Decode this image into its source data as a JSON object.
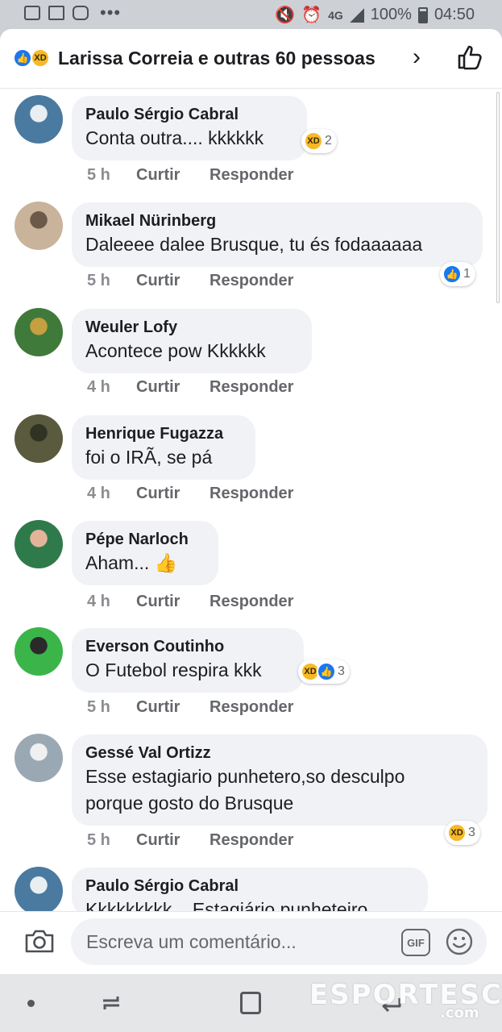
{
  "status_bar": {
    "network": "4G",
    "battery": "100%",
    "time": "04:50",
    "overflow": "•••"
  },
  "header": {
    "title": "Larissa Correia e outras 60 pessoas",
    "reactions": [
      "like",
      "haha"
    ]
  },
  "actions": {
    "like": "Curtir",
    "reply": "Responder"
  },
  "comments": [
    {
      "name": "Paulo Sérgio Cabral",
      "text": "Conta outra.... kkkkkk",
      "time": "5 h",
      "reaction_count": "2",
      "reactions": [
        "haha"
      ],
      "avatar_colors": [
        "#4a7aa0",
        "#e8eef2"
      ]
    },
    {
      "name": "Mikael Nürinberg",
      "text": "Daleeee dalee Brusque, tu és fodaaaaaa",
      "time": "5 h",
      "reaction_count": "1",
      "reactions": [
        "like"
      ],
      "avatar_colors": [
        "#c9b39a",
        "#6b5a48"
      ]
    },
    {
      "name": "Weuler Lofy",
      "text": "Acontece pow Kkkkkk",
      "time": "4 h",
      "reaction_count": "",
      "reactions": [],
      "avatar_colors": [
        "#3f7a3a",
        "#c4a040"
      ]
    },
    {
      "name": "Henrique Fugazza",
      "text": "foi o IRÃ, se pá",
      "time": "4 h",
      "reaction_count": "",
      "reactions": [],
      "avatar_colors": [
        "#5a5a3e",
        "#2e3322"
      ]
    },
    {
      "name": "Pépe Narloch",
      "text": "Aham... 👍",
      "time": "4 h",
      "reaction_count": "",
      "reactions": [],
      "avatar_colors": [
        "#2f7a4a",
        "#e4b49a"
      ]
    },
    {
      "name": "Everson Coutinho",
      "text": "O Futebol respira kkk",
      "time": "5 h",
      "reaction_count": "3",
      "reactions": [
        "haha",
        "like"
      ],
      "avatar_colors": [
        "#3bb54a",
        "#2a2a2a"
      ]
    },
    {
      "name": "Gessé Val Ortizz",
      "text": "Esse estagiario punhetero,so desculpo",
      "text2": "porque gosto do Brusque",
      "time": "5 h",
      "reaction_count": "3",
      "reactions": [
        "haha"
      ],
      "avatar_colors": [
        "#9aa8b4",
        "#f0f0f0"
      ]
    },
    {
      "name": "Paulo Sérgio Cabral",
      "text": "Kkkkkkkkk... Estagiário punheteiro",
      "time": "",
      "reaction_count": "",
      "reactions": [],
      "avatar_colors": [
        "#4a7aa0",
        "#e8eef2"
      ]
    }
  ],
  "composer": {
    "placeholder": "Escreva um comentário...",
    "gif_label": "GIF"
  },
  "watermark": {
    "main": "ESPORTESC",
    "sub": ".com"
  }
}
